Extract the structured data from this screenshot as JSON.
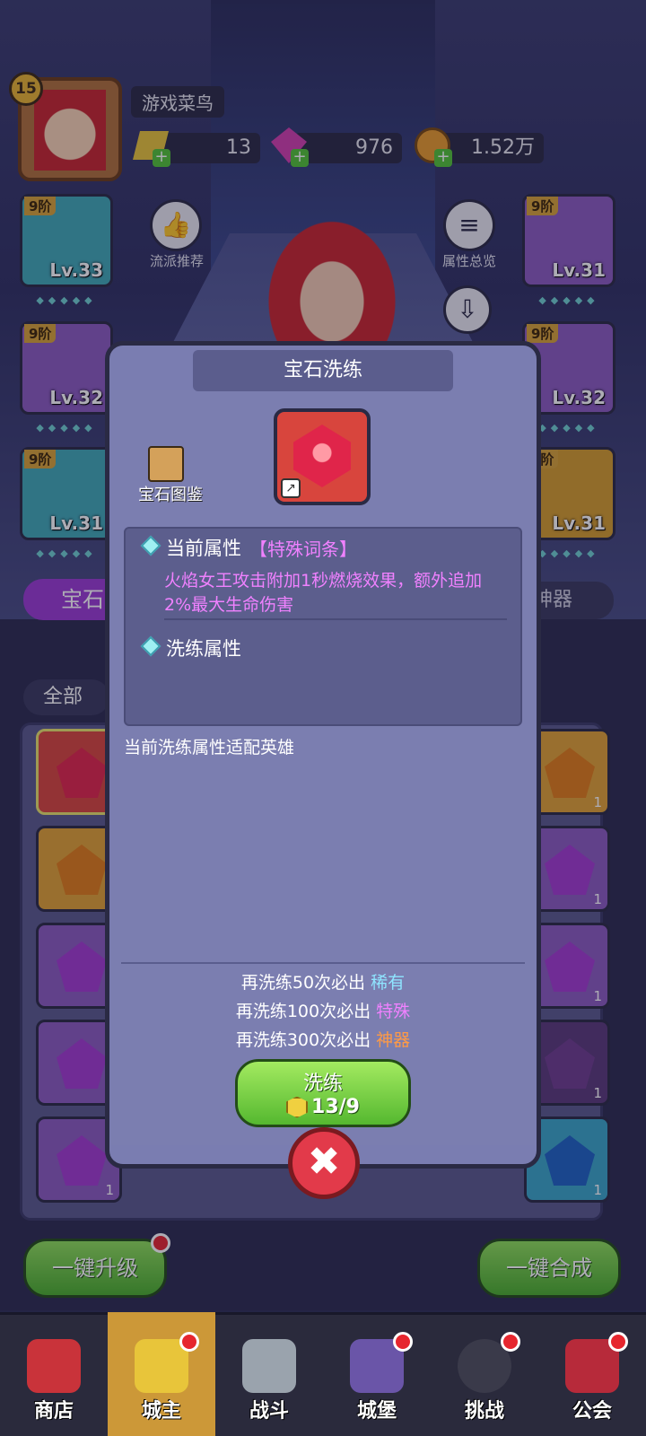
{
  "player": {
    "level": "15",
    "name": "游戏菜鸟"
  },
  "resources": {
    "gold_bars": "13",
    "gems": "976",
    "coins": "1.52万"
  },
  "equipment": {
    "left": [
      {
        "tier": "9阶",
        "level": "Lv.33"
      },
      {
        "tier": "9阶",
        "level": "Lv.32"
      },
      {
        "tier": "9阶",
        "level": "Lv.31"
      }
    ],
    "right": [
      {
        "tier": "9阶",
        "level": "Lv.31"
      },
      {
        "tier": "9阶",
        "level": "Lv.32"
      },
      {
        "tier": "9阶",
        "level": "Lv.31"
      }
    ]
  },
  "side_buttons": {
    "recommend": "流派推荐",
    "overview": "属性总览"
  },
  "tabs": {
    "gem": "宝石",
    "artifact": "神器"
  },
  "filter": {
    "all": "全部"
  },
  "grid_counts": [
    "1",
    "1",
    "1",
    "1",
    "1",
    "1",
    "1",
    "1",
    "1",
    "1",
    "1",
    "1"
  ],
  "actions": {
    "upgrade_all": "一键升级",
    "merge_all": "一键合成"
  },
  "nav": [
    "商店",
    "城主",
    "战斗",
    "城堡",
    "挑战",
    "公会"
  ],
  "modal": {
    "title": "宝石洗练",
    "codex": "宝石图鉴",
    "current_label": "当前属性",
    "special_tag": "【特殊词条】",
    "effect": "火焰女王攻击附加1秒燃烧效果，额外追加2%最大生命伤害",
    "refine_label": "洗练属性",
    "fit_note": "当前洗练属性适配英雄",
    "guarantee": [
      {
        "prefix": "再洗练50次必出",
        "quality": "稀有"
      },
      {
        "prefix": "再洗练100次必出",
        "quality": "特殊"
      },
      {
        "prefix": "再洗练300次必出",
        "quality": "神器"
      }
    ],
    "refine_button": "洗练",
    "cost": "13/9"
  }
}
